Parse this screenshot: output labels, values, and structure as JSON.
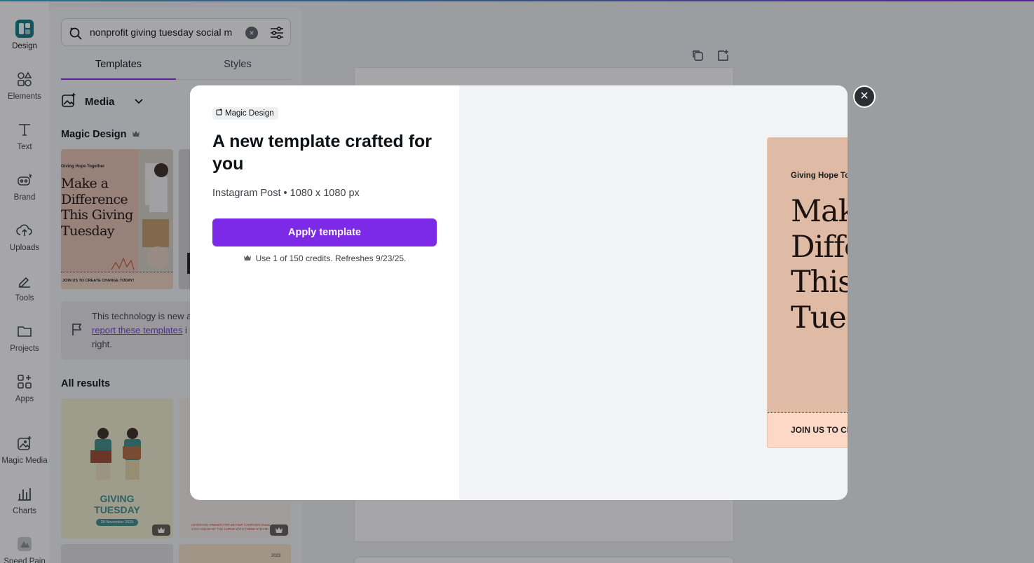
{
  "rail": {
    "items": [
      {
        "label": "Design",
        "icon": "design-icon"
      },
      {
        "label": "Elements",
        "icon": "elements-icon"
      },
      {
        "label": "Text",
        "icon": "text-icon"
      },
      {
        "label": "Brand",
        "icon": "brand-icon"
      },
      {
        "label": "Uploads",
        "icon": "uploads-icon"
      },
      {
        "label": "Tools",
        "icon": "tools-icon"
      },
      {
        "label": "Projects",
        "icon": "projects-icon"
      },
      {
        "label": "Apps",
        "icon": "apps-icon"
      },
      {
        "label": "Magic Media",
        "icon": "magic-media-icon"
      },
      {
        "label": "Charts",
        "icon": "charts-icon"
      },
      {
        "label": "Speed Pain",
        "icon": "app-icon"
      }
    ]
  },
  "panel": {
    "search_value": "nonprofit giving tuesday social m",
    "tabs": [
      {
        "label": "Templates"
      },
      {
        "label": "Styles"
      }
    ],
    "media_label": "Media",
    "magic_design_title": "Magic Design",
    "notice": {
      "line1": "This technology is new a",
      "link": "report these templates",
      "after_link": " i",
      "line3": "right."
    },
    "all_results_title": "All results",
    "thumbs": {
      "magic1": {
        "top": "Giving Hope Together",
        "title": "Make a Difference This Giving Tuesday",
        "footer": "JOIN US TO CREATE CHANGE TODAY!"
      },
      "result1": {
        "title_line1": "GIVING",
        "title_line2": "TUESDAY",
        "date": "28 November 2025"
      },
      "result2": {
        "line1": "LEVERAGE TRENDS FOR BETTER CAMPAIGN INSIG",
        "line2": "STAY AHEAD OF THE CURVE WITH THESE STRATE"
      },
      "result4": {
        "year": "2023"
      }
    }
  },
  "modal": {
    "chip_label": "Magic Design",
    "title": "A new template crafted for you",
    "subtitle": "Instagram Post • 1080 x 1080 px",
    "apply_label": "Apply template",
    "credits_text": "Use 1 of 150 credits. Refreshes 9/23/25.",
    "close_label": "×"
  },
  "preview": {
    "top_text": "Giving Hope Together",
    "title": "Make a Difference This Giving Tuesday",
    "footer": "JOIN US TO CREATE CHANGE TODAY!"
  },
  "colors": {
    "accent": "#7d2ae8",
    "design_active": "#0e7c86",
    "preview_bg": "#dfbba6",
    "preview_footer": "#fbd9c6"
  }
}
